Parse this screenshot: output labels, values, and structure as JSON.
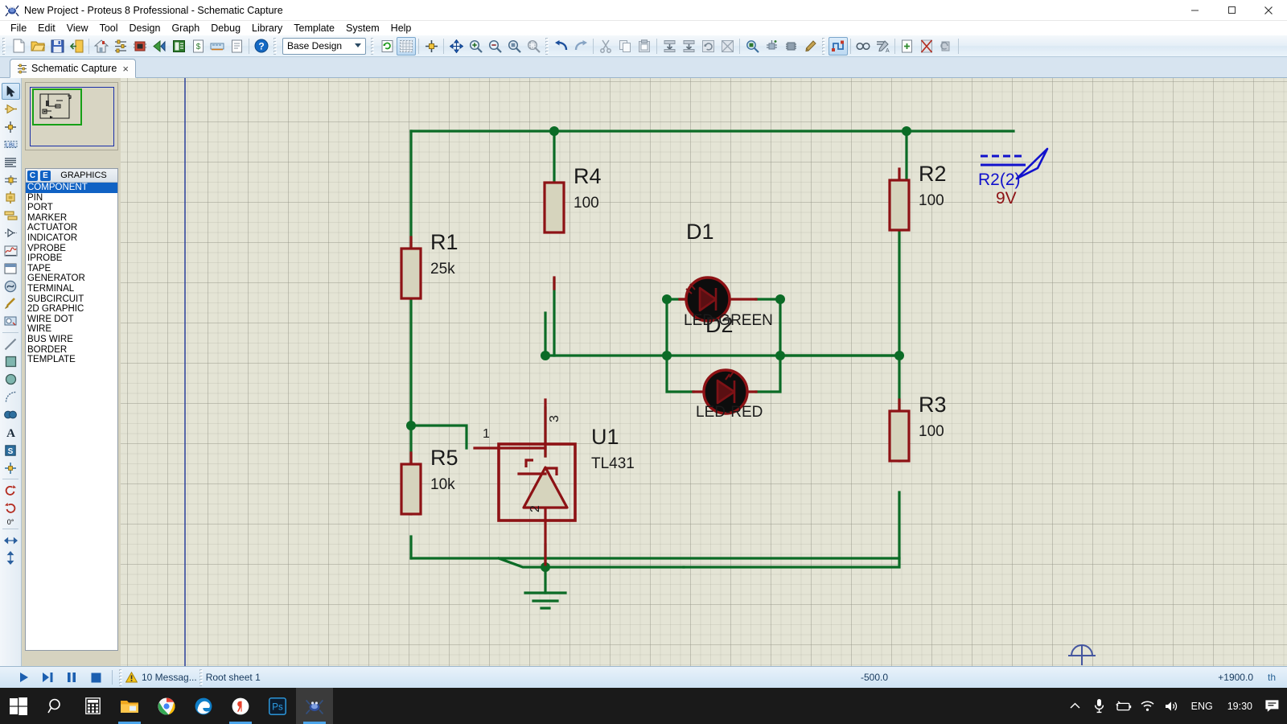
{
  "window": {
    "title": "New Project - Proteus 8 Professional - Schematic Capture",
    "app_icon": "proteus-icon",
    "minimize_label": "─",
    "maximize_label": "❐",
    "close_label": "✕"
  },
  "menubar": {
    "items": [
      {
        "label": "File"
      },
      {
        "label": "Edit"
      },
      {
        "label": "View"
      },
      {
        "label": "Tool"
      },
      {
        "label": "Design"
      },
      {
        "label": "Graph"
      },
      {
        "label": "Debug"
      },
      {
        "label": "Library"
      },
      {
        "label": "Template"
      },
      {
        "label": "System"
      },
      {
        "label": "Help"
      }
    ]
  },
  "toolbar": {
    "group_file": [
      {
        "name": "new-project-icon",
        "title": "New Project"
      },
      {
        "name": "open-project-icon",
        "title": "Open Project"
      },
      {
        "name": "save-project-icon",
        "title": "Save Project"
      },
      {
        "name": "import-export-icon",
        "title": "Import / Export"
      }
    ],
    "group_modules": [
      {
        "name": "home-icon",
        "title": "Home Page"
      },
      {
        "name": "schematic-capture-icon",
        "title": "Schematic Capture"
      },
      {
        "name": "pcb-layout-icon",
        "title": "PCB Layout"
      },
      {
        "name": "3d-viewer-icon",
        "title": "3D Visualizer"
      },
      {
        "name": "design-explorer-icon",
        "title": "Design Explorer"
      },
      {
        "name": "bom-icon",
        "title": "Bill of Materials"
      },
      {
        "name": "source-code-icon",
        "title": "Source Code"
      },
      {
        "name": "gerber-icon",
        "title": "Gerber Viewer"
      },
      {
        "name": "report-icon",
        "title": "Report"
      },
      {
        "name": "help-icon",
        "title": "Help"
      }
    ],
    "design_selector": {
      "value": "Base Design",
      "name": "design-selector"
    },
    "group_view": [
      {
        "name": "refresh-icon",
        "title": "Redraw"
      },
      {
        "name": "toggle-grid-icon",
        "title": "Toggle Grid",
        "active": true
      },
      {
        "name": "origin-icon",
        "title": "Set Origin"
      },
      {
        "name": "pan-icon",
        "title": "Pan"
      },
      {
        "name": "zoom-in-icon",
        "title": "Zoom In"
      },
      {
        "name": "zoom-out-icon",
        "title": "Zoom Out"
      },
      {
        "name": "zoom-all-icon",
        "title": "Zoom To View Entire Sheet"
      },
      {
        "name": "zoom-area-icon",
        "title": "Zoom To Area"
      }
    ],
    "group_edit": [
      {
        "name": "undo-icon",
        "title": "Undo"
      },
      {
        "name": "redo-icon",
        "title": "Redo"
      },
      {
        "name": "cut-icon",
        "title": "Cut"
      },
      {
        "name": "copy-icon",
        "title": "Copy"
      },
      {
        "name": "paste-icon",
        "title": "Paste"
      },
      {
        "name": "block-copy-icon",
        "title": "Block Copy"
      },
      {
        "name": "block-move-icon",
        "title": "Block Move"
      },
      {
        "name": "block-rotate-icon",
        "title": "Block Rotate"
      },
      {
        "name": "block-delete-icon",
        "title": "Block Delete"
      },
      {
        "name": "pick-device-icon",
        "title": "Pick Device"
      },
      {
        "name": "make-device-icon",
        "title": "Make Device"
      },
      {
        "name": "packaging-tool-icon",
        "title": "Packaging Tool"
      },
      {
        "name": "decompose-icon",
        "title": "Decompose"
      }
    ],
    "group_tools": [
      {
        "name": "wire-autorouter-icon",
        "title": "Wire Auto Router",
        "active": true
      },
      {
        "name": "search-tag-icon",
        "title": "Search and Tag"
      },
      {
        "name": "property-assignment-icon",
        "title": "Property Assignment Tool"
      },
      {
        "name": "new-sheet-icon",
        "title": "New Sheet"
      },
      {
        "name": "remove-sheet-icon",
        "title": "Remove Sheet"
      },
      {
        "name": "exit-sheet-icon",
        "title": "Exit Sheet"
      }
    ]
  },
  "tabs": [
    {
      "label": "Schematic Capture",
      "icon": "schematic-tab-icon",
      "close": "×",
      "active": true
    }
  ],
  "rail": {
    "tools": [
      {
        "name": "selection-mode-icon",
        "selected": true
      },
      {
        "name": "component-mode-icon"
      },
      {
        "name": "junction-dot-mode-icon"
      },
      {
        "name": "wire-label-mode-icon"
      },
      {
        "name": "text-script-mode-icon"
      },
      {
        "name": "bus-mode-icon"
      },
      {
        "name": "subcircuit-mode-icon"
      },
      {
        "name": "terminals-mode-icon"
      },
      {
        "name": "device-pins-mode-icon"
      },
      {
        "name": "graph-mode-icon"
      },
      {
        "name": "tape-recorder-mode-icon"
      },
      {
        "name": "generator-mode-icon"
      },
      {
        "name": "voltage-probe-mode-icon"
      },
      {
        "name": "current-probe-mode-icon"
      },
      {
        "name": "virtual-instrument-icon"
      },
      {
        "name": "line-tool-icon"
      },
      {
        "name": "box-tool-icon"
      },
      {
        "name": "circle-tool-icon"
      },
      {
        "name": "arc-tool-icon"
      },
      {
        "name": "path-tool-icon"
      },
      {
        "name": "text-tool-icon"
      },
      {
        "name": "symbol-tool-icon"
      },
      {
        "name": "marker-tool-icon"
      }
    ],
    "rotation": {
      "value": "0°",
      "name": "rotation-value"
    },
    "orient": [
      {
        "name": "rotate-ccw-icon"
      },
      {
        "name": "rotate-cw-icon"
      },
      {
        "name": "mirror-horizontal-icon"
      },
      {
        "name": "mirror-vertical-icon"
      }
    ]
  },
  "picker": {
    "badges": [
      "C",
      "E"
    ],
    "title": "GRAPHICS",
    "items": [
      {
        "label": "COMPONENT",
        "selected": true
      },
      {
        "label": "PIN"
      },
      {
        "label": "PORT"
      },
      {
        "label": "MARKER"
      },
      {
        "label": "ACTUATOR"
      },
      {
        "label": "INDICATOR"
      },
      {
        "label": "VPROBE"
      },
      {
        "label": "IPROBE"
      },
      {
        "label": "TAPE"
      },
      {
        "label": "GENERATOR"
      },
      {
        "label": "TERMINAL"
      },
      {
        "label": "SUBCIRCUIT"
      },
      {
        "label": "2D GRAPHIC"
      },
      {
        "label": "WIRE DOT"
      },
      {
        "label": "WIRE"
      },
      {
        "label": "BUS WIRE"
      },
      {
        "label": "BORDER"
      },
      {
        "label": "TEMPLATE"
      }
    ]
  },
  "schematic": {
    "colors": {
      "wire": "#0b6b26",
      "body": "#8d1215",
      "fill": "#d6d4bd",
      "led_body": "#0d0d0d",
      "text": "#1a1a1a",
      "probe_label": "#1111cc",
      "probe_value": "#8d1215",
      "background": "#e4e4d5"
    },
    "components": [
      {
        "ref": "R1",
        "value": "25k",
        "type": "resistor"
      },
      {
        "ref": "R2",
        "value": "100",
        "type": "resistor"
      },
      {
        "ref": "R3",
        "value": "100",
        "type": "resistor"
      },
      {
        "ref": "R4",
        "value": "100",
        "type": "resistor"
      },
      {
        "ref": "R5",
        "value": "10k",
        "type": "resistor"
      },
      {
        "ref": "D1",
        "value": "LED-GREEN",
        "type": "led"
      },
      {
        "ref": "D2",
        "value": "LED-RED",
        "type": "led"
      },
      {
        "ref": "U1",
        "value": "TL431",
        "type": "shunt-regulator",
        "pins": [
          "1",
          "2",
          "3"
        ]
      }
    ],
    "probe": {
      "label": "R2(2)",
      "value": "9V",
      "type": "voltage-probe"
    },
    "ground": {
      "name": "ground-symbol"
    }
  },
  "statusbar": {
    "animate_buttons": [
      {
        "name": "play-button",
        "glyph": "▶"
      },
      {
        "name": "step-button",
        "glyph": "▶❘"
      },
      {
        "name": "pause-button",
        "glyph": "❘❘"
      },
      {
        "name": "stop-button",
        "glyph": "■"
      }
    ],
    "messages": {
      "icon": "warning-icon",
      "label": "10 Messag..."
    },
    "sheet": "Root sheet 1",
    "coord_x": "-500.0",
    "coord_y": "+1900.0",
    "units": "th"
  },
  "taskbar": {
    "buttons": [
      {
        "name": "start-button",
        "icon": "windows-logo-icon"
      },
      {
        "name": "search-button",
        "icon": "search-icon"
      },
      {
        "name": "calculator-button",
        "icon": "calculator-icon"
      },
      {
        "name": "file-explorer-button",
        "icon": "folder-icon",
        "running": true
      },
      {
        "name": "chrome-button",
        "icon": "chrome-icon"
      },
      {
        "name": "edge-button",
        "icon": "edge-icon"
      },
      {
        "name": "yandex-button",
        "icon": "yandex-icon",
        "running": true
      },
      {
        "name": "photoshop-button",
        "icon": "photoshop-icon"
      },
      {
        "name": "proteus-button",
        "icon": "proteus-icon",
        "running": true,
        "focused": true
      }
    ],
    "tray": {
      "show_hidden": "∧",
      "icons": [
        {
          "name": "microphone-icon"
        },
        {
          "name": "battery-icon"
        },
        {
          "name": "wifi-icon"
        },
        {
          "name": "volume-icon"
        }
      ],
      "language": "ENG",
      "clock": "19:30",
      "notifications": "notifications-icon"
    }
  }
}
